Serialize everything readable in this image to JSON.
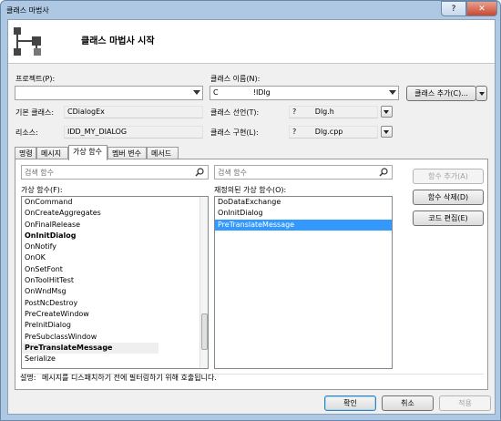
{
  "window": {
    "title": "클래스 마법사",
    "help_label": "?",
    "close_label": "✕"
  },
  "header": {
    "title": "클래스 마법사 시작",
    "icon": "class-wizard-icon"
  },
  "project": {
    "label": "프로젝트(P):",
    "value": ""
  },
  "class_name": {
    "label": "클래스 이름(N):",
    "value": "C               !IDlg"
  },
  "add_class_button": "클래스 추가(C)...",
  "base_class": {
    "label": "기본 클래스:",
    "value": "CDialogEx"
  },
  "class_declaration": {
    "label": "클래스 선언(T):",
    "prefix": "?",
    "value": "Dlg.h"
  },
  "resource": {
    "label": "리소스:",
    "value": "IDD_MY_DIALOG"
  },
  "class_implementation": {
    "label": "클래스 구현(L):",
    "prefix": "?",
    "value": "Dlg.cpp"
  },
  "tabs": [
    {
      "label": "명령"
    },
    {
      "label": "메시지"
    },
    {
      "label": "가상 함수"
    },
    {
      "label": "멤버 변수"
    },
    {
      "label": "메서드"
    }
  ],
  "active_tab": "가상 함수",
  "left_search_placeholder": "검색 함수",
  "right_search_placeholder": "검색 함수",
  "virtual_functions": {
    "label": "가상 함수(F):",
    "items": [
      {
        "text": "OnCommand",
        "bold": false
      },
      {
        "text": "OnCreateAggregates",
        "bold": false
      },
      {
        "text": "OnFinalRelease",
        "bold": false
      },
      {
        "text": "OnInitDialog",
        "bold": true
      },
      {
        "text": "OnNotify",
        "bold": false
      },
      {
        "text": "OnOK",
        "bold": false
      },
      {
        "text": "OnSetFont",
        "bold": false
      },
      {
        "text": "OnToolHitTest",
        "bold": false
      },
      {
        "text": "OnWndMsg",
        "bold": false
      },
      {
        "text": "PostNcDestroy",
        "bold": false
      },
      {
        "text": "PreCreateWindow",
        "bold": false
      },
      {
        "text": "PreInitDialog",
        "bold": false
      },
      {
        "text": "PreSubclassWindow",
        "bold": false
      },
      {
        "text": "PreTranslateMessage",
        "bold": true,
        "highlighted": true
      },
      {
        "text": "Serialize",
        "bold": false
      }
    ]
  },
  "overridden_functions": {
    "label": "재정의된 가상 함수(O):",
    "items": [
      {
        "text": "DoDataExchange",
        "selected": false
      },
      {
        "text": "OnInitDialog",
        "selected": false
      },
      {
        "text": "PreTranslateMessage",
        "selected": true
      }
    ]
  },
  "side_buttons": {
    "add_function": "함수 추가(A)",
    "delete_function": "함수 삭제(D)",
    "edit_code": "코드 편집(E)"
  },
  "description": {
    "label": "설명:",
    "text": "메시지를 디스패치하기 전에 필터링하기 위해 호출됩니다."
  },
  "footer_buttons": {
    "ok": "확인",
    "cancel": "취소",
    "apply": "적용"
  },
  "colors": {
    "selection": "#3399ff",
    "frame": "#aec8e4"
  }
}
